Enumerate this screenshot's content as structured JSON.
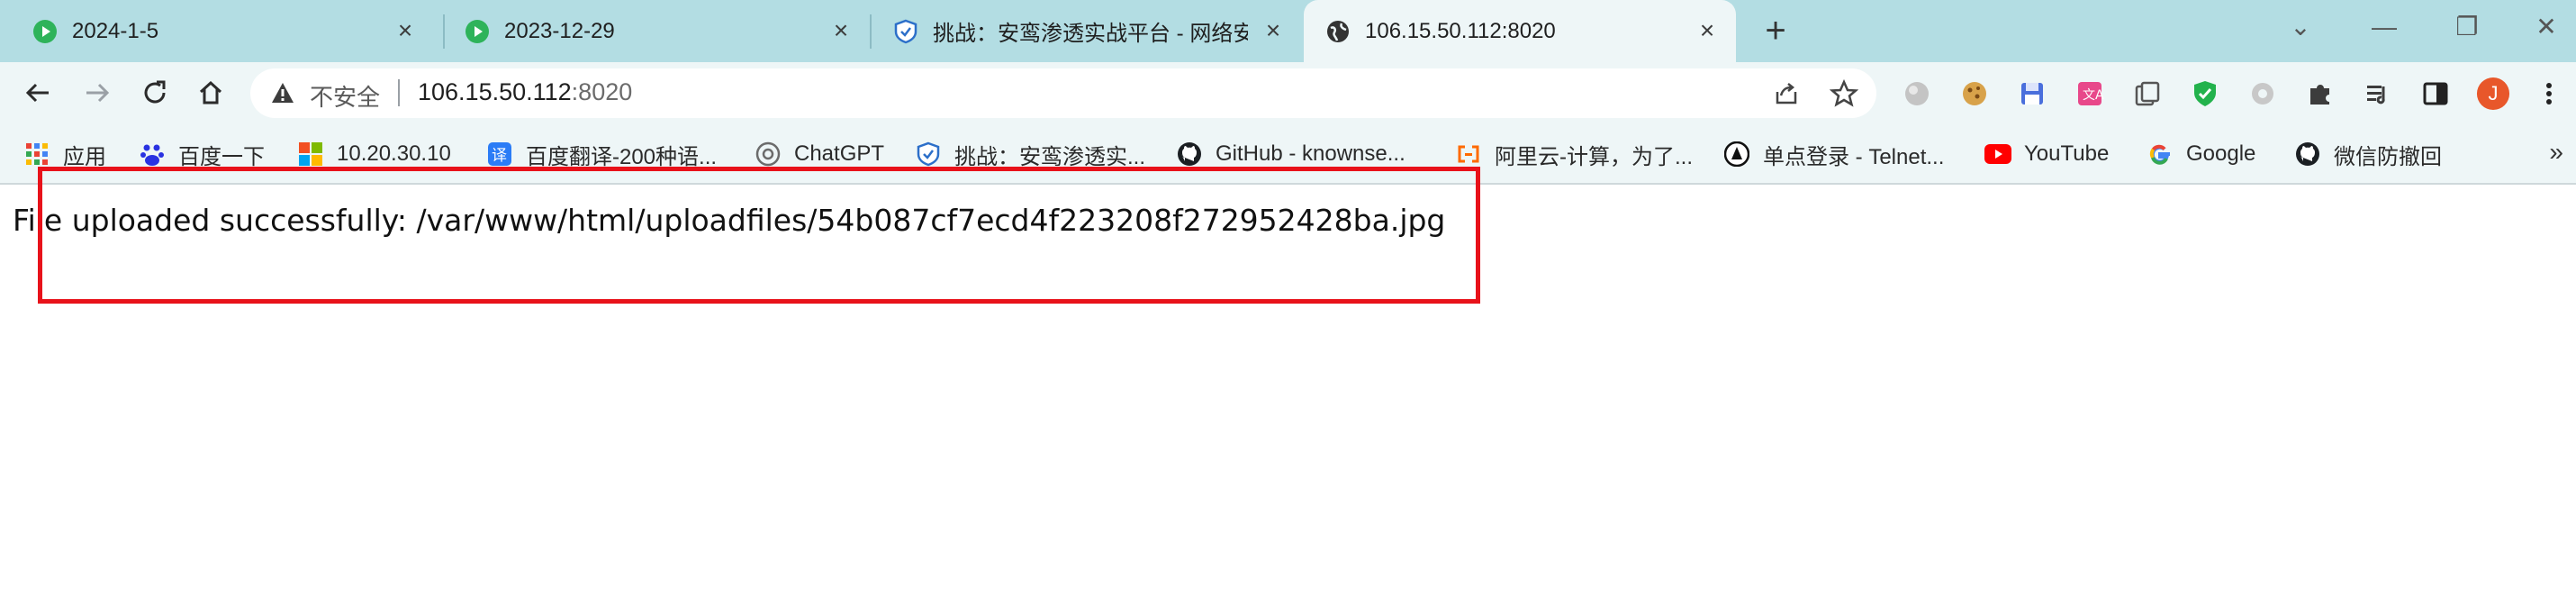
{
  "tabs": [
    {
      "title": "2024-1-5",
      "close": "×",
      "icon": "play-green-icon"
    },
    {
      "title": "2023-12-29",
      "close": "×",
      "icon": "play-green-icon"
    },
    {
      "title": "挑战：安鸾渗透实战平台 - 网络安",
      "close": "×",
      "icon": "shield-blue-icon"
    },
    {
      "title": "106.15.50.112:8020",
      "close": "×",
      "icon": "globe-icon",
      "active": true
    }
  ],
  "new_tab": "+",
  "window_controls": {
    "dropdown": "⌄",
    "minimize": "—",
    "restore": "❐",
    "close": "✕"
  },
  "omnibox": {
    "security_label": "不安全",
    "url_host": "106.15.50.112",
    "url_port": ":8020"
  },
  "profile_initial": "J",
  "bookmarks": [
    {
      "label": "应用",
      "icon": "apps-grid-icon"
    },
    {
      "label": "百度一下",
      "icon": "baidu-paw-icon"
    },
    {
      "label": "10.20.30.10",
      "icon": "windows-logo-icon"
    },
    {
      "label": "百度翻译-200种语...",
      "icon": "translate-icon"
    },
    {
      "label": "ChatGPT",
      "icon": "chatgpt-icon"
    },
    {
      "label": "挑战：安鸾渗透实...",
      "icon": "shield-blue-icon"
    },
    {
      "label": "GitHub - knownse...",
      "icon": "github-icon"
    },
    {
      "label": "阿里云-计算，为了...",
      "icon": "aliyun-icon"
    },
    {
      "label": "单点登录 - Telnet...",
      "icon": "telnet-icon"
    },
    {
      "label": "YouTube",
      "icon": "youtube-icon"
    },
    {
      "label": "Google",
      "icon": "google-icon"
    },
    {
      "label": "微信防撤回",
      "icon": "github-icon"
    }
  ],
  "bookmarks_more": "»",
  "page": {
    "message": "File uploaded successfully: /var/www/html/uploadfiles/54b087cf7ecd4f223208f272952428ba.jpg"
  },
  "colors": {
    "chrome": "#b3dde3",
    "toolbar": "#eef6f7",
    "highlight": "#e8121a",
    "profile": "#e8572a"
  }
}
